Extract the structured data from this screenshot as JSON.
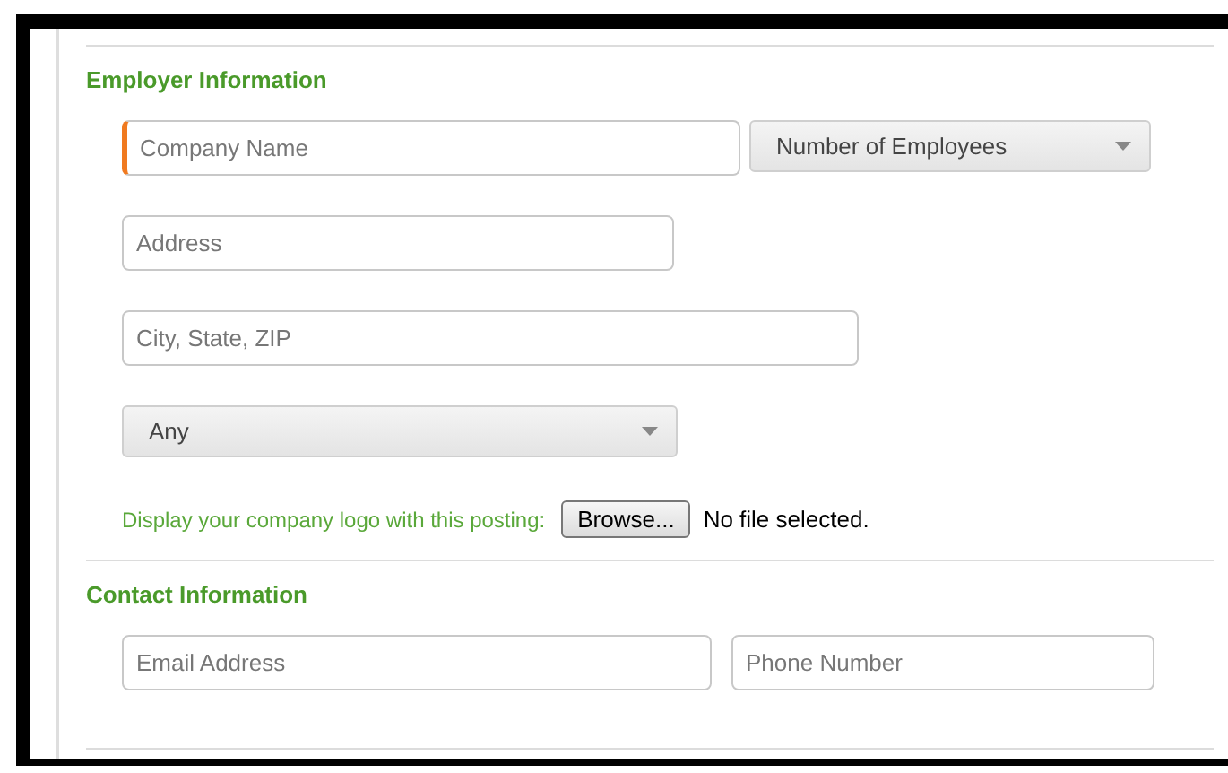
{
  "sections": [
    {
      "title": "Employer Information",
      "rows": [
        [
          {
            "kind": "text",
            "placeholder": "Company Name",
            "focused": true
          },
          {
            "kind": "select",
            "value": "Number of Employees"
          }
        ],
        [
          {
            "kind": "text",
            "placeholder": "Address",
            "focused": false
          }
        ],
        [
          {
            "kind": "text",
            "placeholder": "City, State, ZIP",
            "focused": false
          }
        ],
        [
          {
            "kind": "select",
            "value": "Any"
          }
        ],
        [
          {
            "kind": "file",
            "label": "Display your company logo with this posting:",
            "button": "Browse...",
            "status": "No file selected."
          }
        ]
      ]
    },
    {
      "title": "Contact Information",
      "rows": [
        [
          {
            "kind": "text",
            "placeholder": "Email Address",
            "focused": false
          },
          {
            "kind": "text",
            "placeholder": "Phone Number",
            "focused": false
          }
        ]
      ]
    }
  ]
}
